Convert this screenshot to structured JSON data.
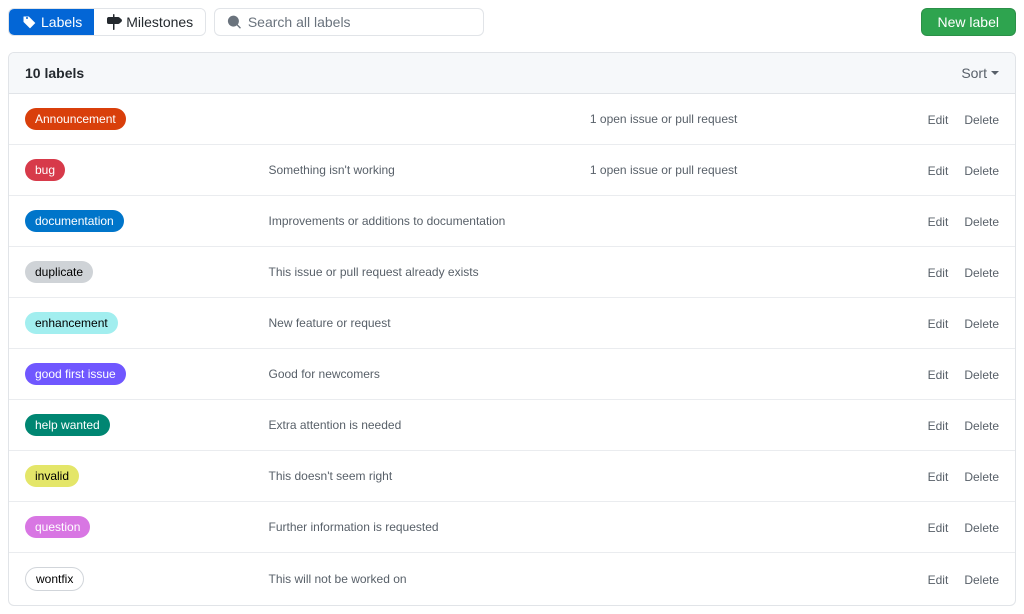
{
  "nav": {
    "labels_tab": "Labels",
    "milestones_tab": "Milestones"
  },
  "search": {
    "placeholder": "Search all labels"
  },
  "buttons": {
    "new_label": "New label",
    "sort": "Sort",
    "edit": "Edit",
    "delete": "Delete"
  },
  "header": {
    "count_text": "10 labels"
  },
  "labels": [
    {
      "name": "Announcement",
      "description": "",
      "usage": "1 open issue or pull request",
      "bg": "#D93F0B",
      "fg": "#ffffff"
    },
    {
      "name": "bug",
      "description": "Something isn't working",
      "usage": "1 open issue or pull request",
      "bg": "#d73a4a",
      "fg": "#ffffff"
    },
    {
      "name": "documentation",
      "description": "Improvements or additions to documentation",
      "usage": "",
      "bg": "#0075ca",
      "fg": "#ffffff"
    },
    {
      "name": "duplicate",
      "description": "This issue or pull request already exists",
      "usage": "",
      "bg": "#cfd3d7",
      "fg": "#000000"
    },
    {
      "name": "enhancement",
      "description": "New feature or request",
      "usage": "",
      "bg": "#a2eeef",
      "fg": "#000000"
    },
    {
      "name": "good first issue",
      "description": "Good for newcomers",
      "usage": "",
      "bg": "#7057ff",
      "fg": "#ffffff"
    },
    {
      "name": "help wanted",
      "description": "Extra attention is needed",
      "usage": "",
      "bg": "#008672",
      "fg": "#ffffff"
    },
    {
      "name": "invalid",
      "description": "This doesn't seem right",
      "usage": "",
      "bg": "#e4e669",
      "fg": "#000000"
    },
    {
      "name": "question",
      "description": "Further information is requested",
      "usage": "",
      "bg": "#d876e3",
      "fg": "#ffffff"
    },
    {
      "name": "wontfix",
      "description": "This will not be worked on",
      "usage": "",
      "bg": "#ffffff",
      "fg": "#000000",
      "border": "#d1d5da"
    }
  ]
}
